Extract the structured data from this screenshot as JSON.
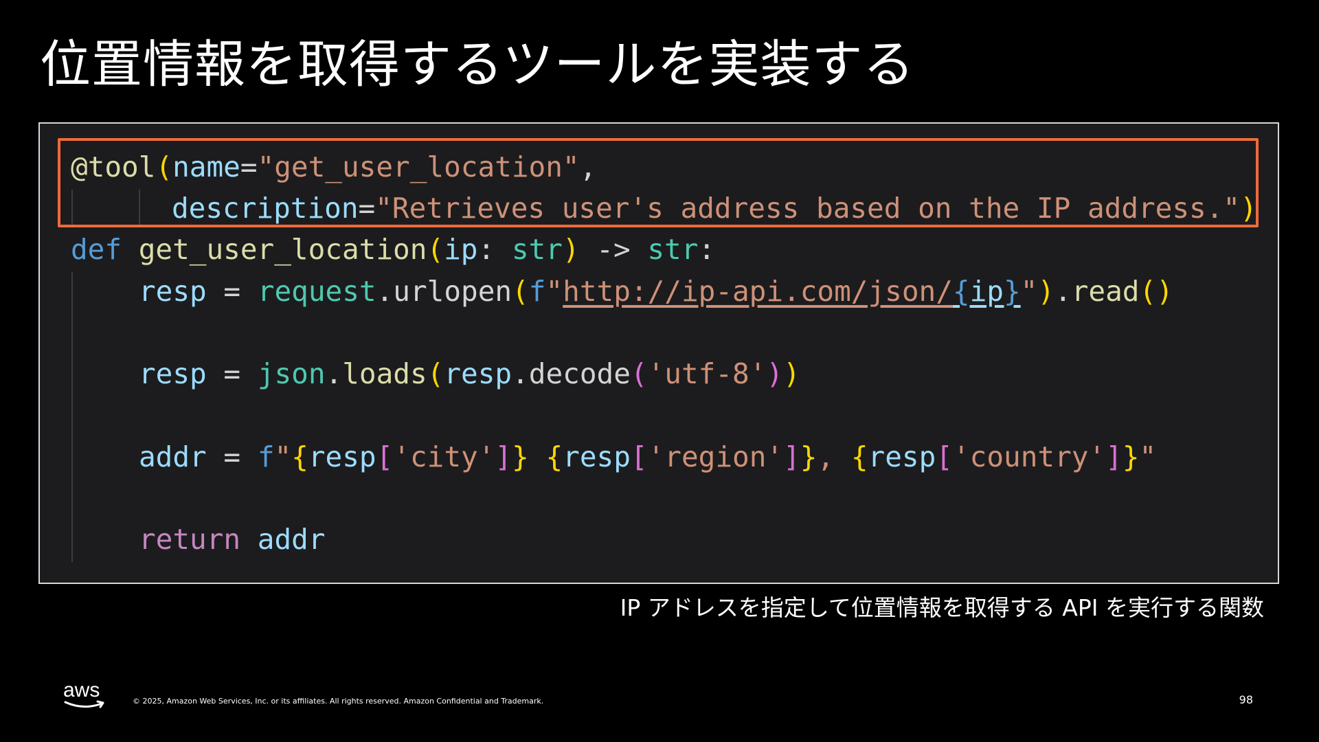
{
  "slide": {
    "title": "位置情報を取得するツールを実装する",
    "caption": "IP アドレスを指定して位置情報を取得する API を実行する関数",
    "copyright": "© 2025, Amazon Web Services, Inc. or its affiliates. All rights reserved. Amazon Confidential and Trademark.",
    "page_number": "98",
    "logo_text": "aws"
  },
  "code": {
    "line1": {
      "at": "@",
      "decorator": "tool",
      "open": "(",
      "param": "name",
      "eq": "=",
      "string": "\"get_user_location\"",
      "comma": ","
    },
    "line2": {
      "param": "description",
      "eq": "=",
      "string": "\"Retrieves user's address based on the IP address.\"",
      "close": ")"
    },
    "line3": {
      "keyword": "def",
      "func": "get_user_location",
      "open": "(",
      "param": "ip",
      "colon": ": ",
      "type": "str",
      "close": ")",
      "arrow": " -> ",
      "rettype": "str",
      "end": ":"
    },
    "line4": {
      "var": "resp",
      "eq": " = ",
      "module": "request",
      "dot": ".",
      "func": "urlopen",
      "open": "(",
      "prefix": "f",
      "quote_open": "\"",
      "url": "http://ip-api.com/json/",
      "brace_open": "{",
      "ip": "ip",
      "brace_close": "}",
      "quote_close": "\"",
      "close": ")",
      "dot2": ".",
      "read": "read",
      "call": "()"
    },
    "line5": {
      "var": "resp",
      "eq": " = ",
      "module": "json",
      "dot": ".",
      "func": "loads",
      "open": "(",
      "arg": "resp",
      "dot2": ".",
      "method": "decode",
      "open2": "(",
      "string": "'utf-8'",
      "close2": ")",
      "close": ")"
    },
    "line6": {
      "var": "addr",
      "eq": " = ",
      "prefix": "f",
      "quote_open": "\"",
      "b1": "{",
      "r1": "resp",
      "sq1o": "[",
      "k1": "'city'",
      "sq1c": "]",
      "b1c": "}",
      "sp1": " ",
      "b2": "{",
      "r2": "resp",
      "sq2o": "[",
      "k2": "'region'",
      "sq2c": "]",
      "b2c": "}",
      "sep": ", ",
      "b3": "{",
      "r3": "resp",
      "sq3o": "[",
      "k3": "'country'",
      "sq3c": "]",
      "b3c": "}",
      "quote_close": "\""
    },
    "line7": {
      "keyword": "return",
      "sp": " ",
      "var": "addr"
    }
  },
  "colors": {
    "background": "#000000",
    "code_background": "#1c1c1e",
    "highlight_border": "#ef6a3a",
    "frame_border": "#d9d9d9"
  }
}
